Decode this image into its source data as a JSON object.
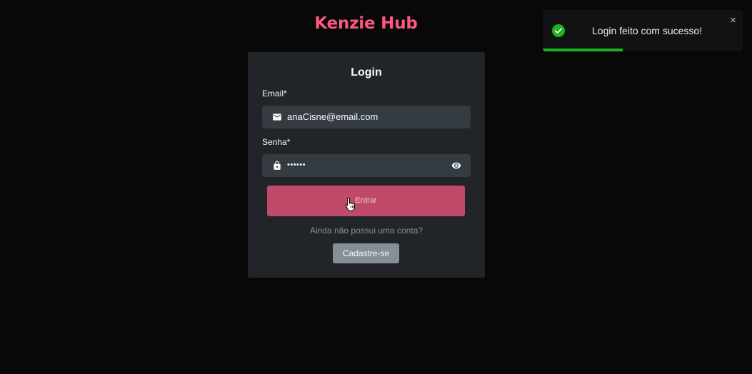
{
  "app": {
    "title": "Kenzie Hub"
  },
  "login": {
    "title": "Login",
    "email_label": "Email*",
    "email_value": "anaCisne@email.com",
    "password_label": "Senha*",
    "password_value": "••••••",
    "submit_label": "Entrar",
    "helper_text": "Ainda não possui uma conta?",
    "register_label": "Cadastre-se"
  },
  "toast": {
    "message": "Login feito com sucesso!",
    "close_glyph": "×",
    "progress": 0.4,
    "status_color": "#1fb31f"
  },
  "icons": {
    "email": "mail-icon",
    "password": "lock-icon",
    "toggle": "eye-icon",
    "toast": "check-circle-icon",
    "cursor": "hand-pointer-icon"
  },
  "colors": {
    "brand": "#ff577f",
    "primary_button": "#c04b68",
    "secondary_button": "#868e96",
    "card": "#212529",
    "input": "#343b41",
    "background": "#080808"
  }
}
